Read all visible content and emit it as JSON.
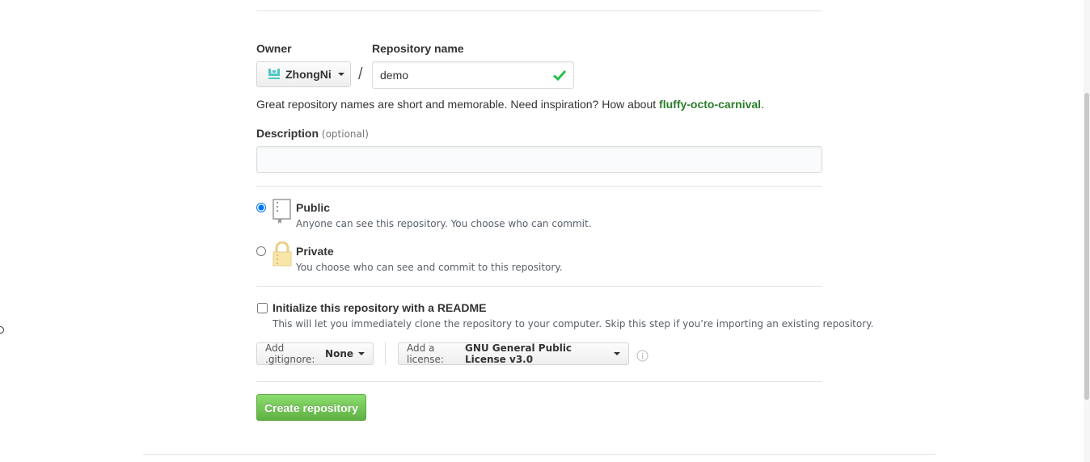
{
  "owner": {
    "label": "Owner",
    "value": "ZhongNi"
  },
  "repo": {
    "label": "Repository name",
    "value": "demo",
    "separator": "/"
  },
  "hint": {
    "text": "Great repository names are short and memorable. Need inspiration? How about ",
    "suggestion": "fluffy-octo-carnival",
    "end": "."
  },
  "description": {
    "label": "Description",
    "optional": "(optional)",
    "value": ""
  },
  "visibility": {
    "public": {
      "title": "Public",
      "note": "Anyone can see this repository. You choose who can commit.",
      "selected": true
    },
    "private": {
      "title": "Private",
      "note": "You choose who can see and commit to this repository.",
      "selected": false
    }
  },
  "readme": {
    "label": "Initialize this repository with a README",
    "note": "This will let you immediately clone the repository to your computer. Skip this step if you’re importing an existing repository.",
    "checked": false
  },
  "gitignore": {
    "prefix": "Add .gitignore:",
    "value": "None"
  },
  "license": {
    "prefix": "Add a license:",
    "value": "GNU General Public License v3.0"
  },
  "create_button": "Create repository",
  "colors": {
    "accent_green": "#2cbe4e",
    "suggestion_green": "#2a7d2a",
    "owner_icon": "#4dc7c7"
  },
  "icons": {
    "owner": "org-avatar-icon",
    "valid": "check-icon",
    "public": "repo-book-icon",
    "private": "lock-icon",
    "info": "info-icon"
  }
}
